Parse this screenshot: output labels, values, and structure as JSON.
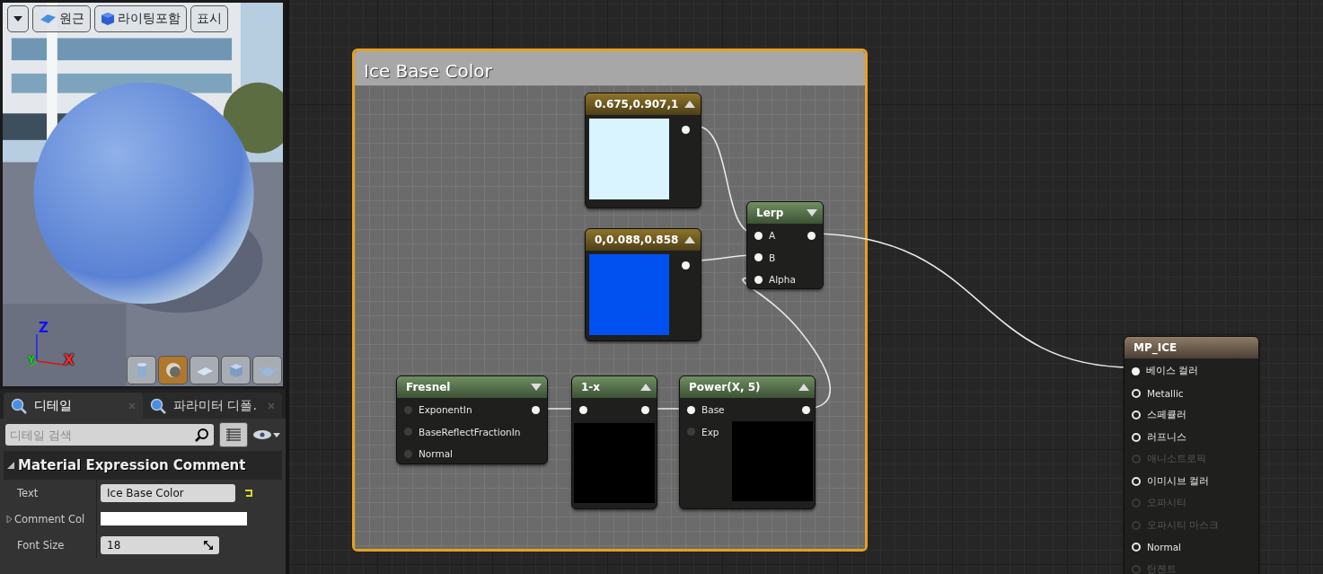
{
  "viewport": {
    "toolbar": [
      {
        "kind": "menu"
      },
      {
        "kind": "view",
        "label": "원근"
      },
      {
        "kind": "lighting",
        "label": "라이팅포함"
      },
      {
        "kind": "show",
        "label": "표시"
      }
    ],
    "axes": {
      "z": "Z",
      "y": "Y",
      "x": "X"
    },
    "preview_shapes": [
      {
        "kind": "cylinder",
        "selected": false
      },
      {
        "kind": "sphere",
        "selected": true
      },
      {
        "kind": "plane",
        "selected": false
      },
      {
        "kind": "cube",
        "selected": false
      },
      {
        "kind": "teapot",
        "selected": false
      }
    ]
  },
  "details": {
    "tabs": [
      {
        "label": "디테일",
        "selected": true
      },
      {
        "label": "파라미터 디폴.",
        "selected": false
      }
    ],
    "search": {
      "placeholder": "디테일 검색"
    },
    "section": {
      "title": "Material Expression Comment",
      "expanded": true
    },
    "properties": [
      {
        "label": "Text",
        "kind": "text",
        "value": "Ice Base Color",
        "modified": true
      },
      {
        "label": "Comment Col",
        "kind": "color",
        "color": "#ffffff",
        "expandable": true
      },
      {
        "label": "Font Size",
        "kind": "number",
        "value": "18"
      }
    ]
  },
  "graph": {
    "comment": {
      "title": "Ice Base Color"
    },
    "nodes": [
      {
        "kind": "constant",
        "title": "0.675,0.907,1",
        "preview_shown": true,
        "color": "#d9f3ff",
        "outputs": [
          {
            "connected": true
          }
        ]
      },
      {
        "kind": "constant",
        "title": "0,0.088,0.858",
        "preview_shown": true,
        "color": "#0051f0",
        "outputs": [
          {
            "connected": true
          }
        ]
      },
      {
        "kind": "function",
        "title": "Lerp",
        "preview_shown": false,
        "inputs": [
          {
            "label": "A",
            "connected": true
          },
          {
            "label": "B",
            "connected": true
          },
          {
            "label": "Alpha",
            "connected": true
          }
        ],
        "outputs": [
          {
            "connected": true
          }
        ]
      },
      {
        "kind": "function",
        "title": "Fresnel",
        "preview_shown": false,
        "inputs": [
          {
            "label": "ExponentIn",
            "connected": false
          },
          {
            "label": "BaseReflectFractionIn",
            "connected": false
          },
          {
            "label": "Normal",
            "connected": false
          }
        ],
        "outputs": [
          {
            "connected": true
          }
        ]
      },
      {
        "kind": "function",
        "title": "1-x",
        "preview_shown": true,
        "color": "#000000",
        "inputs": [
          {
            "connected": true
          }
        ],
        "outputs": [
          {
            "connected": true
          }
        ]
      },
      {
        "kind": "function",
        "title": "Power(X, 5)",
        "preview_shown": true,
        "color": "#000000",
        "inputs": [
          {
            "label": "Base",
            "connected": true
          },
          {
            "label": "Exp",
            "connected": false
          }
        ],
        "outputs": [
          {
            "connected": true
          }
        ]
      }
    ],
    "material": {
      "title": "MP_ICE",
      "pins": [
        {
          "label": "베이스 컬러",
          "enabled": true,
          "connected": true
        },
        {
          "label": "Metallic",
          "enabled": true,
          "connected": false
        },
        {
          "label": "스페큘러",
          "enabled": true,
          "connected": false
        },
        {
          "label": "러프니스",
          "enabled": true,
          "connected": false
        },
        {
          "label": "애니소트로픽",
          "enabled": false,
          "connected": false
        },
        {
          "label": "이미시브 컬러",
          "enabled": true,
          "connected": false
        },
        {
          "label": "오파시티",
          "enabled": false,
          "connected": false
        },
        {
          "label": "오파시티 마스크",
          "enabled": false,
          "connected": false
        },
        {
          "label": "Normal",
          "enabled": true,
          "connected": false
        },
        {
          "label": "탄젠트",
          "enabled": false,
          "connected": false
        }
      ]
    }
  }
}
